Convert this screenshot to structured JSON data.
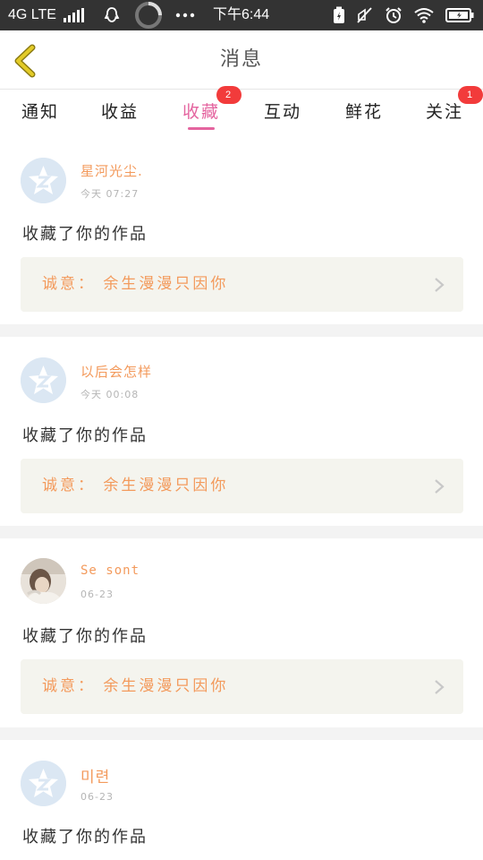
{
  "status_bar": {
    "network": "4G LTE",
    "time": "下午6:44"
  },
  "header": {
    "title": "消息"
  },
  "tabs": [
    {
      "label": "通知",
      "badge": ""
    },
    {
      "label": "收益",
      "badge": ""
    },
    {
      "label": "收藏",
      "badge": "2",
      "active": true
    },
    {
      "label": "互动",
      "badge": ""
    },
    {
      "label": "鲜花",
      "badge": ""
    },
    {
      "label": "关注",
      "badge": "1"
    }
  ],
  "messages": [
    {
      "name": "星河光尘.",
      "time": "今天 07:27",
      "action": "收藏了你的作品",
      "work": "诚意： 余生漫漫只因你",
      "avatar": "default"
    },
    {
      "name": "以后会怎样",
      "time": "今天 00:08",
      "action": "收藏了你的作品",
      "work": "诚意： 余生漫漫只因你",
      "avatar": "default"
    },
    {
      "name": "Se sont",
      "time": "06-23",
      "action": "收藏了你的作品",
      "work": "诚意： 余生漫漫只因你",
      "avatar": "photo"
    },
    {
      "name": "미련",
      "time": "06-23",
      "action": "收藏了你的作品",
      "work": "",
      "avatar": "default"
    }
  ],
  "colors": {
    "accent": "#e4649f",
    "name": "#f39a5c",
    "badge": "#f23b3b",
    "back_arrow": "#d9c21a"
  }
}
